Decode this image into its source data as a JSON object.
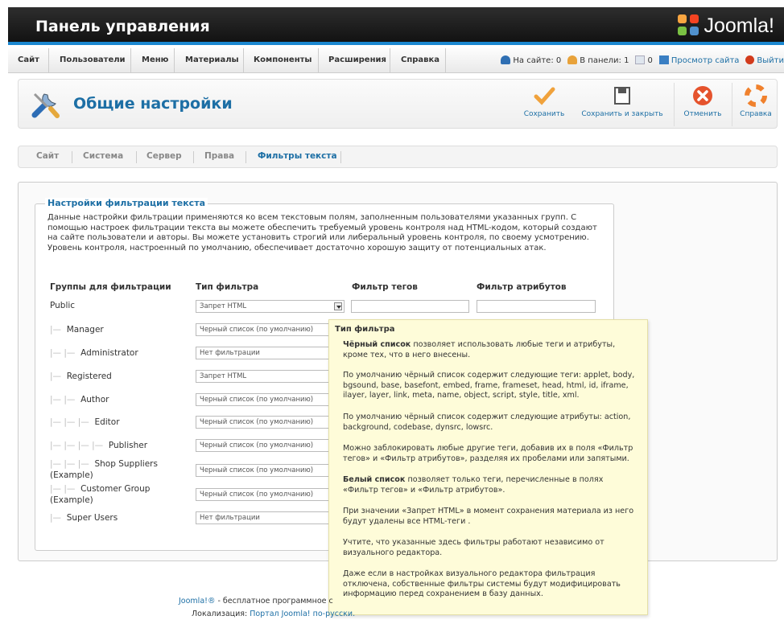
{
  "header": {
    "title": "Панель управления",
    "logo_text": "Joomla!"
  },
  "menu": [
    "Сайт",
    "Пользователи",
    "Меню",
    "Материалы",
    "Компоненты",
    "Расширения",
    "Справка"
  ],
  "status": {
    "on_site": "На сайте: 0",
    "in_admin": "В панели: 1",
    "messages": "0",
    "preview": "Просмотр сайта",
    "logout": "Выйти"
  },
  "toolbar": {
    "title": "Общие настройки",
    "save": "Сохранить",
    "save_close": "Сохранить и закрыть",
    "cancel": "Отменить",
    "help": "Справка"
  },
  "tabs": [
    "Сайт",
    "Система",
    "Сервер",
    "Права",
    "Фильтры текста"
  ],
  "active_tab": "Фильтры текста",
  "filters": {
    "legend": "Настройки фильтрации текста",
    "intro": "Данные настройки фильтрации применяются ко всем текстовым полям, заполненным пользователями указанных групп. С помощью настроек фильтрации текста вы можете обеспечить требуемый уровень контроля над HTML-кодом, который создают на сайте пользователи и авторы. Вы можете установить строгий или либеральный уровень контроля, по своему усмотрению. Уровень контроля, настроенный по умолчанию, обеспечивает достаточно хорошую защиту от потенциальных атак.",
    "col_groups": "Группы для фильтрации",
    "col_type": "Тип фильтра",
    "col_tags": "Фильтр тегов",
    "col_attrs": "Фильтр атрибутов",
    "rows": [
      {
        "group": "Public",
        "filter": "Запрет HTML"
      },
      {
        "group": "Manager",
        "filter": "Черный список (по умолчанию)"
      },
      {
        "group": "Administrator",
        "filter": "Нет фильтрации"
      },
      {
        "group": "Registered",
        "filter": "Запрет HTML"
      },
      {
        "group": "Author",
        "filter": "Черный список (по умолчанию)"
      },
      {
        "group": "Editor",
        "filter": "Черный список (по умолчанию)"
      },
      {
        "group": "Publisher",
        "filter": "Черный список (по умолчанию)"
      },
      {
        "group": "Shop Suppliers",
        "group_extra": "(Example)",
        "filter": "Черный список (по умолчанию)"
      },
      {
        "group": "Customer Group",
        "group_extra": "(Example)",
        "filter": "Черный список (по умолчанию)"
      },
      {
        "group": "Super Users",
        "filter": "Нет фильтрации"
      }
    ]
  },
  "tooltip": {
    "title": "Тип фильтра",
    "p1_bold": "Чёрный список",
    "p1": " позволяет использовать любые теги и атрибуты, кроме тех, что в него внесены.",
    "p2": "По умолчанию чёрный список содержит следующие теги: applet, body, bgsound, base, basefont, embed, frame, frameset, head, html, id, iframe, ilayer, layer, link, meta, name, object, script, style, title, xml.",
    "p3": "По умолчанию чёрный список содержит следующие атрибуты: action, background, codebase, dynsrc, lowsrc.",
    "p4": "Можно заблокировать любые другие теги, добавив их в поля «Фильтр тегов» и «Фильтр атрибутов», разделяя их пробелами или запятыми.",
    "p5_bold": "Белый список",
    "p5": " позволяет только теги, перечисленные в полях «Фильтр тегов» и «Фильтр атрибутов».",
    "p6": "При значении «Запрет HTML» в момент сохранения материала из него будут удалены все HTML-теги .",
    "p7": "Учтите, что указанные здесь фильтры работают независимо от визуального редактора.",
    "p8": "Даже если в настройках визуального редактора фильтрация отключена, собственные фильтры системы будут модифицировать информацию перед сохранением в базу данных."
  },
  "footer": {
    "joomla_link": "Joomla!®",
    "line1": " - бесплатное программное с",
    "loc_label": "Локализация: ",
    "loc_link": "Портал Joomla! по-русски."
  }
}
